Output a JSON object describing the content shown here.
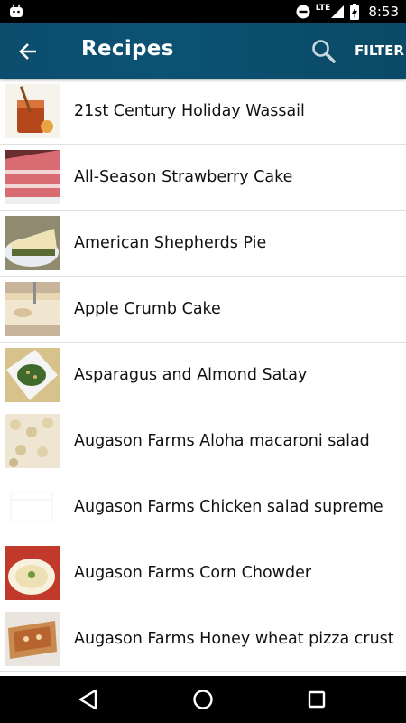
{
  "status_bar": {
    "network": "LTE",
    "time": "8:53"
  },
  "app_bar": {
    "title": "Recipes",
    "filter_label": "FILTER"
  },
  "recipes": [
    {
      "label": "21st Century Holiday Wassail",
      "thumb": "tea-glass"
    },
    {
      "label": "All-Season Strawberry Cake",
      "thumb": "pink-cake"
    },
    {
      "label": "American Shepherds Pie",
      "thumb": "pie-plate"
    },
    {
      "label": "Apple Crumb Cake",
      "thumb": "crumb-cake"
    },
    {
      "label": "Asparagus and Almond Satay",
      "thumb": "green-salad"
    },
    {
      "label": "Augason Farms Aloha macaroni salad",
      "thumb": "macaroni"
    },
    {
      "label": "Augason Farms Chicken salad supreme",
      "thumb": "blank"
    },
    {
      "label": "Augason Farms Corn Chowder",
      "thumb": "soup-bowl"
    },
    {
      "label": "Augason Farms Honey wheat pizza crust",
      "thumb": "pizza"
    }
  ]
}
